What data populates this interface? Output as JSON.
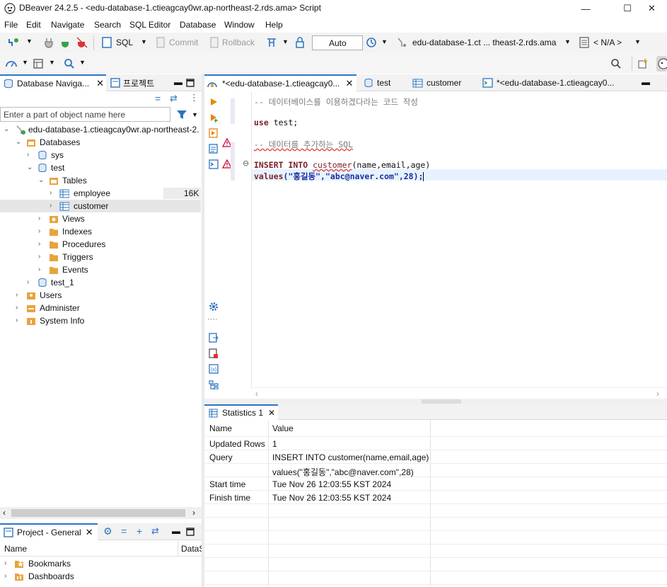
{
  "window": {
    "title": "DBeaver 24.2.5 - <edu-database-1.ctieagcay0wr.ap-northeast-2.rds.ama> Script"
  },
  "menu": [
    "File",
    "Edit",
    "Navigate",
    "Search",
    "SQL Editor",
    "Database",
    "Window",
    "Help"
  ],
  "toolbar": {
    "sql_label": "SQL",
    "commit_label": "Commit",
    "rollback_label": "Rollback",
    "transaction_mode": "Auto",
    "connection_label": "edu-database-1.ct ... theast-2.rds.ama",
    "schema_label": "< N/A >"
  },
  "navigator": {
    "tab_label": "Database Naviga...",
    "projects_tab_label": "프로젝트",
    "filter_placeholder": "Enter a part of object name here",
    "tree": [
      {
        "label": "edu-database-1.ctieagcay0wr.ap-northeast-2.",
        "level": 0
      },
      {
        "label": "Databases",
        "level": 1
      },
      {
        "label": "sys",
        "level": 2
      },
      {
        "label": "test",
        "level": 2
      },
      {
        "label": "Tables",
        "level": 3
      },
      {
        "label": "employee",
        "level": 4,
        "size": "16K"
      },
      {
        "label": "customer",
        "level": 4
      },
      {
        "label": "Views",
        "level": 3
      },
      {
        "label": "Indexes",
        "level": 3
      },
      {
        "label": "Procedures",
        "level": 3
      },
      {
        "label": "Triggers",
        "level": 3
      },
      {
        "label": "Events",
        "level": 3
      },
      {
        "label": "test_1",
        "level": 2
      },
      {
        "label": "Users",
        "level": 1
      },
      {
        "label": "Administer",
        "level": 1
      },
      {
        "label": "System Info",
        "level": 1
      }
    ]
  },
  "project_panel": {
    "tab_label": "Project - General",
    "col_name": "Name",
    "col_datasource": "DataS",
    "items": [
      "Bookmarks",
      "Dashboards"
    ]
  },
  "editor_tabs": [
    {
      "label": "*<edu-database-1.ctieagcay0...",
      "active": true
    },
    {
      "label": "test"
    },
    {
      "label": "customer"
    },
    {
      "label": "*<edu-database-1.ctieagcay0..."
    }
  ],
  "code": {
    "line1": "-- 데이터베이스를 이용하겠다라는 코드 작성",
    "line2_kw": "use",
    "line2_rest": " test;",
    "line3": "-- 데이터를 추가하는 SQL",
    "line4_kw": "INSERT INTO",
    "line4_table": "customer",
    "line4_cols": "(name,email,age)",
    "line5_kw": "values",
    "line5_args": "(\"홍길동\",\"abc@naver.com\",28);"
  },
  "results": {
    "tab_label": "Statistics 1",
    "header_name": "Name",
    "header_value": "Value",
    "rows": [
      {
        "name": "Updated Rows",
        "value": "1"
      },
      {
        "name": "Query",
        "value": "INSERT INTO customer(name,email,age)"
      },
      {
        "name": "",
        "value": "values(\"홍길동\",\"abc@naver.com\",28)"
      },
      {
        "name": "Start time",
        "value": "Tue Nov 26 12:03:55 KST 2024"
      },
      {
        "name": "Finish time",
        "value": "Tue Nov 26 12:03:55 KST 2024"
      }
    ]
  },
  "colors": {
    "accent": "#2f74c0",
    "keyword": "#7b1f2a",
    "string": "#1a2fa0",
    "comment": "#7a7a7a",
    "selection": "#e6e6e6",
    "folder": "#e8a33d"
  }
}
